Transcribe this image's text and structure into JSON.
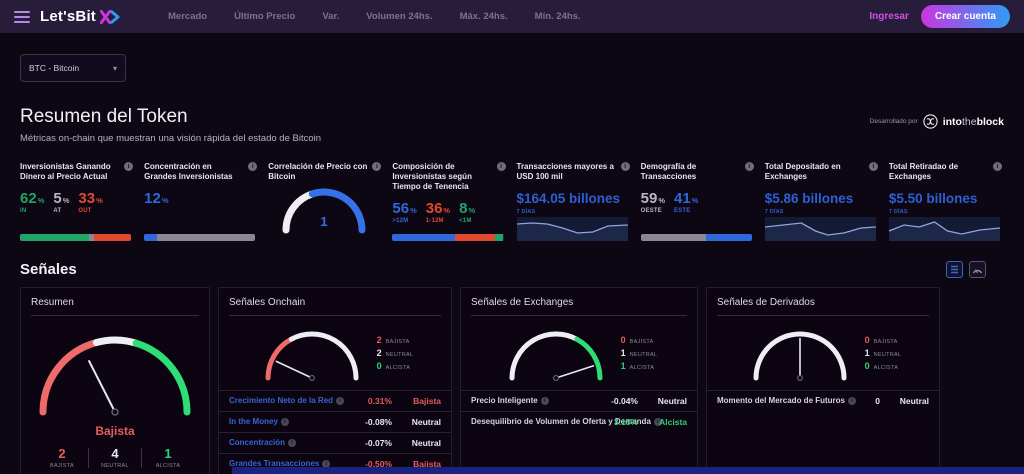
{
  "nav": {
    "logo": "Let'sBit",
    "items": [
      "Mercado",
      "Último Precio",
      "Var.",
      "Volumen 24hs.",
      "Máx. 24hs.",
      "Mín. 24hs."
    ],
    "login": "Ingresar",
    "signup": "Crear cuenta"
  },
  "token_select": {
    "value": "BTC - Bitcoin",
    "chevron": "▾"
  },
  "summary": {
    "title": "Resumen del Token",
    "subtitle": "Métricas on-chain que muestran una visión rápida del estado de Bitcoin",
    "powered_by": "Desarrollado por",
    "provider_parts": {
      "p1": "into",
      "p2": "the",
      "p3": "block"
    }
  },
  "colors": {
    "bearish": "#e25d5d",
    "neutral": "#e8e6ee",
    "bullish": "#2bd178",
    "accent_blue": "#2e68d9",
    "value_blue": "#2e5fd3",
    "green": "#1fa567",
    "red": "#e0492f",
    "gray": "#b9b6c2",
    "bar_gray": "#8a8794",
    "brand_magenta": "#c936e0",
    "brand_blue": "#2e9bf5"
  },
  "metrics": [
    {
      "title": "Inversionistas Ganando Dinero al Precio Actual",
      "stats": [
        {
          "value": "62",
          "unit": "%",
          "label": "IN",
          "color": "#1fa567"
        },
        {
          "value": "5",
          "unit": "%",
          "label": "AT",
          "color": "#b9b6c2"
        },
        {
          "value": "33",
          "unit": "%",
          "label": "OUT",
          "color": "#e0492f"
        }
      ],
      "bar": [
        {
          "pct": 62,
          "color": "#1fa567"
        },
        {
          "pct": 5,
          "color": "#8a8794"
        },
        {
          "pct": 33,
          "color": "#e0492f"
        }
      ]
    },
    {
      "title": "Concentración en Grandes Inversionistas",
      "stats": [
        {
          "value": "12",
          "unit": "%",
          "label": "",
          "color": "#2e68d9"
        }
      ],
      "bar": [
        {
          "pct": 12,
          "color": "#2e68d9"
        },
        {
          "pct": 88,
          "color": "#8a8794"
        }
      ]
    },
    {
      "title": "Correlación de Precio con Bitcoin",
      "gauge_value": "1"
    },
    {
      "title": "Composición de Inversionistas según Tiempo de Tenencia",
      "stats": [
        {
          "value": "56",
          "unit": "%",
          "label": ">12M",
          "color": "#2e68d9"
        },
        {
          "value": "36",
          "unit": "%",
          "label": "1-12M",
          "color": "#e0492f"
        },
        {
          "value": "8",
          "unit": "%",
          "label": "<1M",
          "color": "#1fa567"
        }
      ],
      "bar": [
        {
          "pct": 56,
          "color": "#2e68d9"
        },
        {
          "pct": 36,
          "color": "#e0492f"
        },
        {
          "pct": 8,
          "color": "#1fa567"
        }
      ]
    },
    {
      "title": "Transacciones mayores a USD 100 mil",
      "value": "$164.05 billones",
      "period": "7 DÍAS",
      "color": "#2e5fd3"
    },
    {
      "title": "Demografía de Transacciones",
      "stats": [
        {
          "value": "59",
          "unit": "%",
          "label": "OESTE",
          "color": "#b9b6c2"
        },
        {
          "value": "41",
          "unit": "%",
          "label": "ESTE",
          "color": "#2e68d9"
        }
      ],
      "bar": [
        {
          "pct": 59,
          "color": "#8a8794"
        },
        {
          "pct": 41,
          "color": "#2e68d9"
        }
      ]
    },
    {
      "title": "Total Depositado en Exchanges",
      "value": "$5.86 billones",
      "period": "7 DÍAS",
      "color": "#2e5fd3"
    },
    {
      "title": "Total Retiradao de Exchanges",
      "value": "$5.50 billones",
      "period": "7 DÍAS",
      "color": "#2e5fd3"
    }
  ],
  "signals": {
    "title": "Señales",
    "legend_labels": {
      "bearish": "BAJISTA",
      "neutral": "NEUTRAL",
      "bullish": "ALCISTA"
    },
    "cards": [
      {
        "title": "Resumen",
        "verdict": "Bajista",
        "verdict_color": "#e25d5d",
        "counts": {
          "bearish": "2",
          "neutral": "4",
          "bullish": "1"
        }
      },
      {
        "title": "Señales Onchain",
        "counts": {
          "bearish": "2",
          "neutral": "2",
          "bullish": "0"
        },
        "rows": [
          {
            "label": "Crecimiento Neto de la Red",
            "value": "0.31%",
            "signal": "Bajista",
            "label_color": "#3565d4",
            "color": "#e25d5d"
          },
          {
            "label": "In the Money",
            "value": "-0.08%",
            "signal": "Neutral",
            "label_color": "#3565d4",
            "color": "#e8e6ee"
          },
          {
            "label": "Concentración",
            "value": "-0.07%",
            "signal": "Neutral",
            "label_color": "#3565d4",
            "color": "#e8e6ee"
          },
          {
            "label": "Grandes Transacciones",
            "value": "-0.50%",
            "signal": "Bajista",
            "label_color": "#3565d4",
            "color": "#e25d5d"
          }
        ]
      },
      {
        "title": "Señales de Exchanges",
        "counts": {
          "bearish": "0",
          "neutral": "1",
          "bullish": "1"
        },
        "rows": [
          {
            "label": "Precio Inteligente",
            "value": "-0.04%",
            "signal": "Neutral",
            "label_color": "#d6d3de",
            "color": "#e8e6ee"
          },
          {
            "label": "Desequilibrio de Volumen de Oferta y Demanda",
            "value": "3.18%",
            "signal": "Alcista",
            "label_color": "#d6d3de",
            "color": "#2bd178"
          }
        ]
      },
      {
        "title": "Señales de Derivados",
        "counts": {
          "bearish": "0",
          "neutral": "1",
          "bullish": "0"
        },
        "rows": [
          {
            "label": "Momento del Mercado de Futuros",
            "value": "0",
            "signal": "Neutral",
            "label_color": "#d6d3de",
            "color": "#e8e6ee"
          }
        ]
      }
    ]
  }
}
